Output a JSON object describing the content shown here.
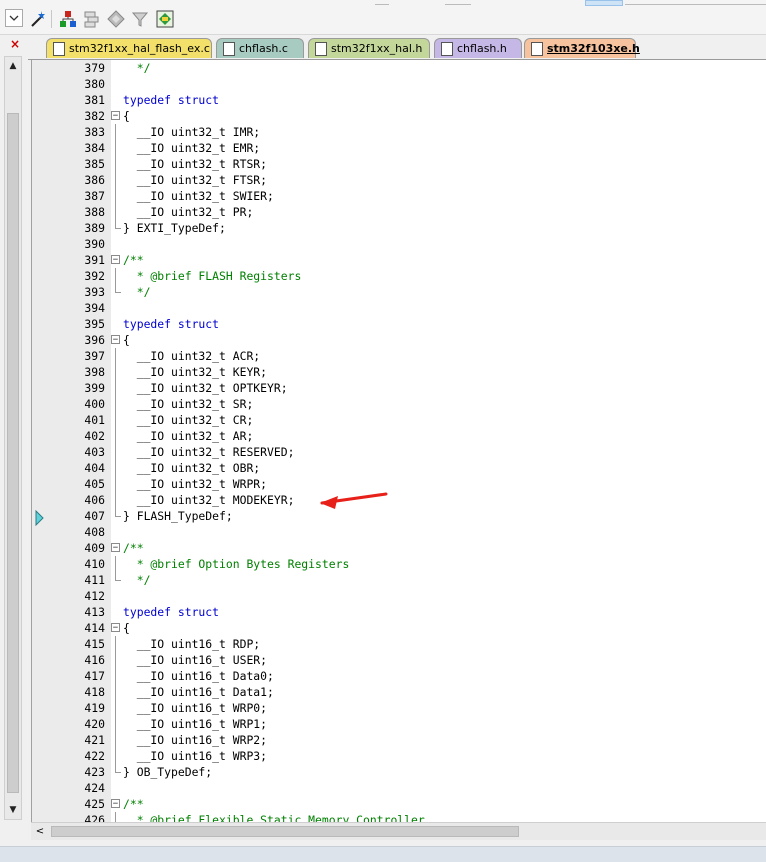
{
  "toolbar": {
    "buttons": [
      {
        "icon": "dropdown-icon"
      },
      {
        "icon": "magic-wand-icon"
      },
      {
        "icon": "hierarchy-icon"
      },
      {
        "icon": "stack-icon"
      },
      {
        "icon": "diamond-icon"
      },
      {
        "icon": "filter-icon"
      },
      {
        "icon": "diagram-icon"
      }
    ]
  },
  "left_panel": {
    "close_glyph": "×"
  },
  "tabs": [
    {
      "label": "stm32f1xx_hal_flash_ex.c",
      "color": "#f2e06a",
      "active": false
    },
    {
      "label": "chflash.c",
      "color": "#a7cbc0",
      "active": false
    },
    {
      "label": "stm32f1xx_hal.h",
      "color": "#c4d79a",
      "active": false
    },
    {
      "label": "chflash.h",
      "color": "#c6b8e6",
      "active": false
    },
    {
      "label": "stm32f103xe.h",
      "color": "#f6c39e",
      "active": true
    }
  ],
  "editor": {
    "lines": [
      {
        "n": "379",
        "text": "  */",
        "cls": "cm"
      },
      {
        "n": "380",
        "text": ""
      },
      {
        "n": "381",
        "text": "typedef struct",
        "cls": "kw"
      },
      {
        "n": "382",
        "text": "{",
        "fold": "open"
      },
      {
        "n": "383",
        "text": "  __IO uint32_t IMR;"
      },
      {
        "n": "384",
        "text": "  __IO uint32_t EMR;"
      },
      {
        "n": "385",
        "text": "  __IO uint32_t RTSR;"
      },
      {
        "n": "386",
        "text": "  __IO uint32_t FTSR;"
      },
      {
        "n": "387",
        "text": "  __IO uint32_t SWIER;"
      },
      {
        "n": "388",
        "text": "  __IO uint32_t PR;"
      },
      {
        "n": "389",
        "text": "} EXTI_TypeDef;",
        "fold": "end"
      },
      {
        "n": "390",
        "text": ""
      },
      {
        "n": "391",
        "text": "/**",
        "cls": "cm",
        "fold": "open"
      },
      {
        "n": "392",
        "text": "  * @brief FLASH Registers",
        "cls": "cm"
      },
      {
        "n": "393",
        "text": "  */",
        "cls": "cm",
        "fold": "end"
      },
      {
        "n": "394",
        "text": ""
      },
      {
        "n": "395",
        "text": "typedef struct",
        "cls": "kw"
      },
      {
        "n": "396",
        "text": "{",
        "fold": "open"
      },
      {
        "n": "397",
        "text": "  __IO uint32_t ACR;"
      },
      {
        "n": "398",
        "text": "  __IO uint32_t KEYR;"
      },
      {
        "n": "399",
        "text": "  __IO uint32_t OPTKEYR;"
      },
      {
        "n": "400",
        "text": "  __IO uint32_t SR;"
      },
      {
        "n": "401",
        "text": "  __IO uint32_t CR;"
      },
      {
        "n": "402",
        "text": "  __IO uint32_t AR;"
      },
      {
        "n": "403",
        "text": "  __IO uint32_t RESERVED;"
      },
      {
        "n": "404",
        "text": "  __IO uint32_t OBR;"
      },
      {
        "n": "405",
        "text": "  __IO uint32_t WRPR;"
      },
      {
        "n": "406",
        "text": "  __IO uint32_t MODEKEYR;"
      },
      {
        "n": "407",
        "text": "} FLASH_TypeDef;",
        "fold": "end"
      },
      {
        "n": "408",
        "text": ""
      },
      {
        "n": "409",
        "text": "/**",
        "cls": "cm",
        "fold": "open"
      },
      {
        "n": "410",
        "text": "  * @brief Option Bytes Registers",
        "cls": "cm"
      },
      {
        "n": "411",
        "text": "  */",
        "cls": "cm",
        "fold": "end"
      },
      {
        "n": "412",
        "text": ""
      },
      {
        "n": "413",
        "text": "typedef struct",
        "cls": "kw"
      },
      {
        "n": "414",
        "text": "{",
        "fold": "open"
      },
      {
        "n": "415",
        "text": "  __IO uint16_t RDP;"
      },
      {
        "n": "416",
        "text": "  __IO uint16_t USER;"
      },
      {
        "n": "417",
        "text": "  __IO uint16_t Data0;"
      },
      {
        "n": "418",
        "text": "  __IO uint16_t Data1;"
      },
      {
        "n": "419",
        "text": "  __IO uint16_t WRP0;"
      },
      {
        "n": "420",
        "text": "  __IO uint16_t WRP1;"
      },
      {
        "n": "421",
        "text": "  __IO uint16_t WRP2;"
      },
      {
        "n": "422",
        "text": "  __IO uint16_t WRP3;"
      },
      {
        "n": "423",
        "text": "} OB_TypeDef;",
        "fold": "end"
      },
      {
        "n": "424",
        "text": ""
      },
      {
        "n": "425",
        "text": "/**",
        "cls": "cm",
        "fold": "open"
      },
      {
        "n": "426",
        "text": "  * @brief Flexible Static Memory Controller",
        "cls": "cm"
      }
    ]
  },
  "annotation": {
    "color": "#e8201a"
  }
}
